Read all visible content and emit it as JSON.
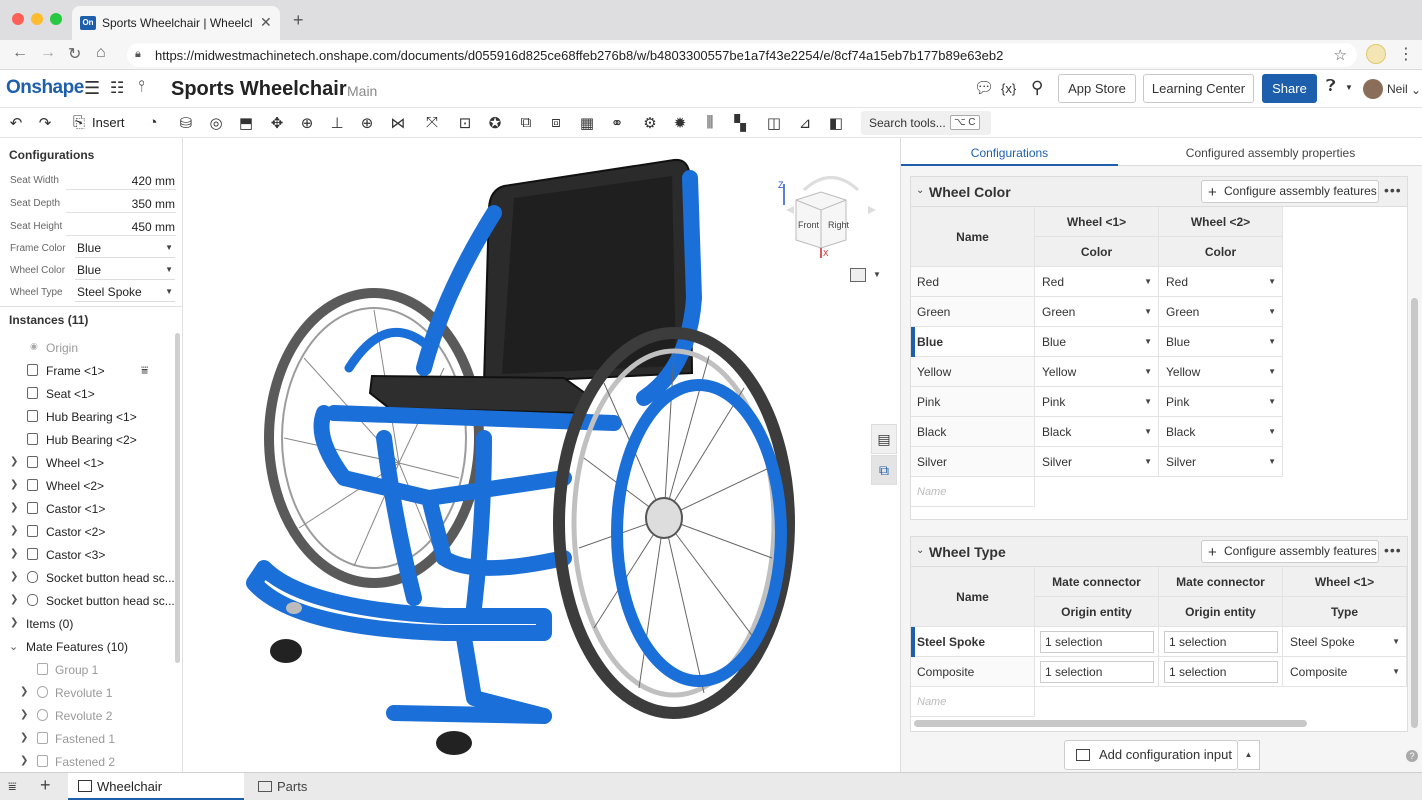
{
  "browser": {
    "tab_title": "Sports Wheelchair | Wheelchair",
    "favicon_text": "On",
    "url": "https://midwestmachinetech.onshape.com/documents/d055916d825ce68ffeb276b8/w/b4803300557be1a7f43e2254/e/8cf74a15eb7b177b89e63eb2"
  },
  "header": {
    "logo": "Onshape",
    "doc_title": "Sports Wheelchair",
    "branch": "Main",
    "app_store": "App Store",
    "learning_center": "Learning Center",
    "share": "Share",
    "user": "Neil",
    "variables_icon_text": "{x}"
  },
  "toolbar": {
    "insert": "Insert",
    "search_tools": "Search tools...",
    "search_shortcut": "⌥ C"
  },
  "left_panel": {
    "configurations_title": "Configurations",
    "params": [
      {
        "label": "Seat Width",
        "value": "420 mm"
      },
      {
        "label": "Seat Depth",
        "value": "350 mm"
      },
      {
        "label": "Seat Height",
        "value": "450 mm"
      },
      {
        "label": "Frame Color",
        "value": "Blue"
      },
      {
        "label": "Wheel Color",
        "value": "Blue"
      },
      {
        "label": "Wheel Type",
        "value": "Steel Spoke"
      }
    ],
    "instances_title": "Instances (11)",
    "tree": [
      {
        "label": "Origin"
      },
      {
        "label": "Frame <1>"
      },
      {
        "label": "Seat <1>"
      },
      {
        "label": "Hub Bearing <1>"
      },
      {
        "label": "Hub Bearing <2>"
      },
      {
        "label": "Wheel <1>"
      },
      {
        "label": "Wheel <2>"
      },
      {
        "label": "Castor <1>"
      },
      {
        "label": "Castor <2>"
      },
      {
        "label": "Castor <3>"
      },
      {
        "label": "Socket button head sc..."
      },
      {
        "label": "Socket button head sc..."
      },
      {
        "label": "Items (0)"
      },
      {
        "label": "Mate Features (10)"
      },
      {
        "label": "Group 1"
      },
      {
        "label": "Revolute 1"
      },
      {
        "label": "Revolute 2"
      },
      {
        "label": "Fastened 1"
      },
      {
        "label": "Fastened 2"
      }
    ]
  },
  "viewcube": {
    "front": "Front",
    "right": "Right",
    "z": "Z",
    "x": "X"
  },
  "right_panel": {
    "tabs": [
      "Configurations",
      "Configured assembly properties"
    ],
    "configure_btn": "Configure assembly features",
    "wheel_color": {
      "title": "Wheel Color",
      "name_header": "Name",
      "col_headers": [
        {
          "top": "Wheel <1>",
          "bottom": "Color"
        },
        {
          "top": "Wheel <2>",
          "bottom": "Color"
        }
      ],
      "rows": [
        {
          "name": "Red",
          "c1": "Red",
          "c2": "Red"
        },
        {
          "name": "Green",
          "c1": "Green",
          "c2": "Green"
        },
        {
          "name": "Blue",
          "c1": "Blue",
          "c2": "Blue"
        },
        {
          "name": "Yellow",
          "c1": "Yellow",
          "c2": "Yellow"
        },
        {
          "name": "Pink",
          "c1": "Pink",
          "c2": "Pink"
        },
        {
          "name": "Black",
          "c1": "Black",
          "c2": "Black"
        },
        {
          "name": "Silver",
          "c1": "Silver",
          "c2": "Silver"
        }
      ],
      "new_placeholder": "Name"
    },
    "wheel_type": {
      "title": "Wheel Type",
      "name_header": "Name",
      "col_headers": [
        {
          "top": "Mate connector",
          "bottom": "Origin entity"
        },
        {
          "top": "Mate connector",
          "bottom": "Origin entity"
        },
        {
          "top": "Wheel <1>",
          "bottom": "Type"
        }
      ],
      "rows": [
        {
          "name": "Steel Spoke",
          "c1": "1 selection",
          "c2": "1 selection",
          "c3": "Steel Spoke"
        },
        {
          "name": "Composite",
          "c1": "1 selection",
          "c2": "1 selection",
          "c3": "Composite"
        }
      ],
      "new_placeholder": "Name"
    },
    "add_config_input": "Add configuration input"
  },
  "bottom_tabs": {
    "wheelchair": "Wheelchair",
    "parts": "Parts"
  },
  "colors": {
    "accent": "#1d5fad",
    "frame_blue": "#1a6fd8"
  }
}
